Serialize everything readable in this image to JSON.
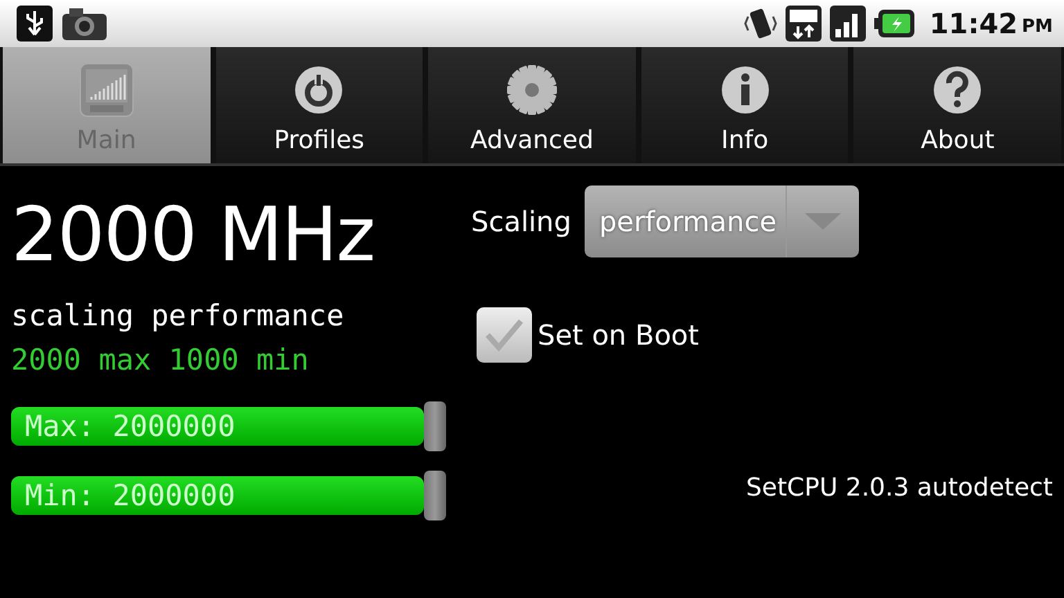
{
  "status_bar": {
    "time": "11:42",
    "ampm": "PM"
  },
  "tabs": [
    {
      "label": "Main",
      "selected": true
    },
    {
      "label": "Profiles",
      "selected": false
    },
    {
      "label": "Advanced",
      "selected": false
    },
    {
      "label": "Info",
      "selected": false
    },
    {
      "label": "About",
      "selected": false
    }
  ],
  "frequency": "2000 MHz",
  "governor_line": "scaling performance",
  "range_line": "2000 max 1000 min",
  "sliders": [
    {
      "label": "Max: 2000000",
      "level": 1.0
    },
    {
      "label": "Min: 2000000",
      "level": 1.0
    }
  ],
  "scaling": {
    "label": "Scaling",
    "value": "performance"
  },
  "set_on_boot": {
    "label": "Set on Boot",
    "checked": true
  },
  "version": "SetCPU 2.0.3 autodetect"
}
